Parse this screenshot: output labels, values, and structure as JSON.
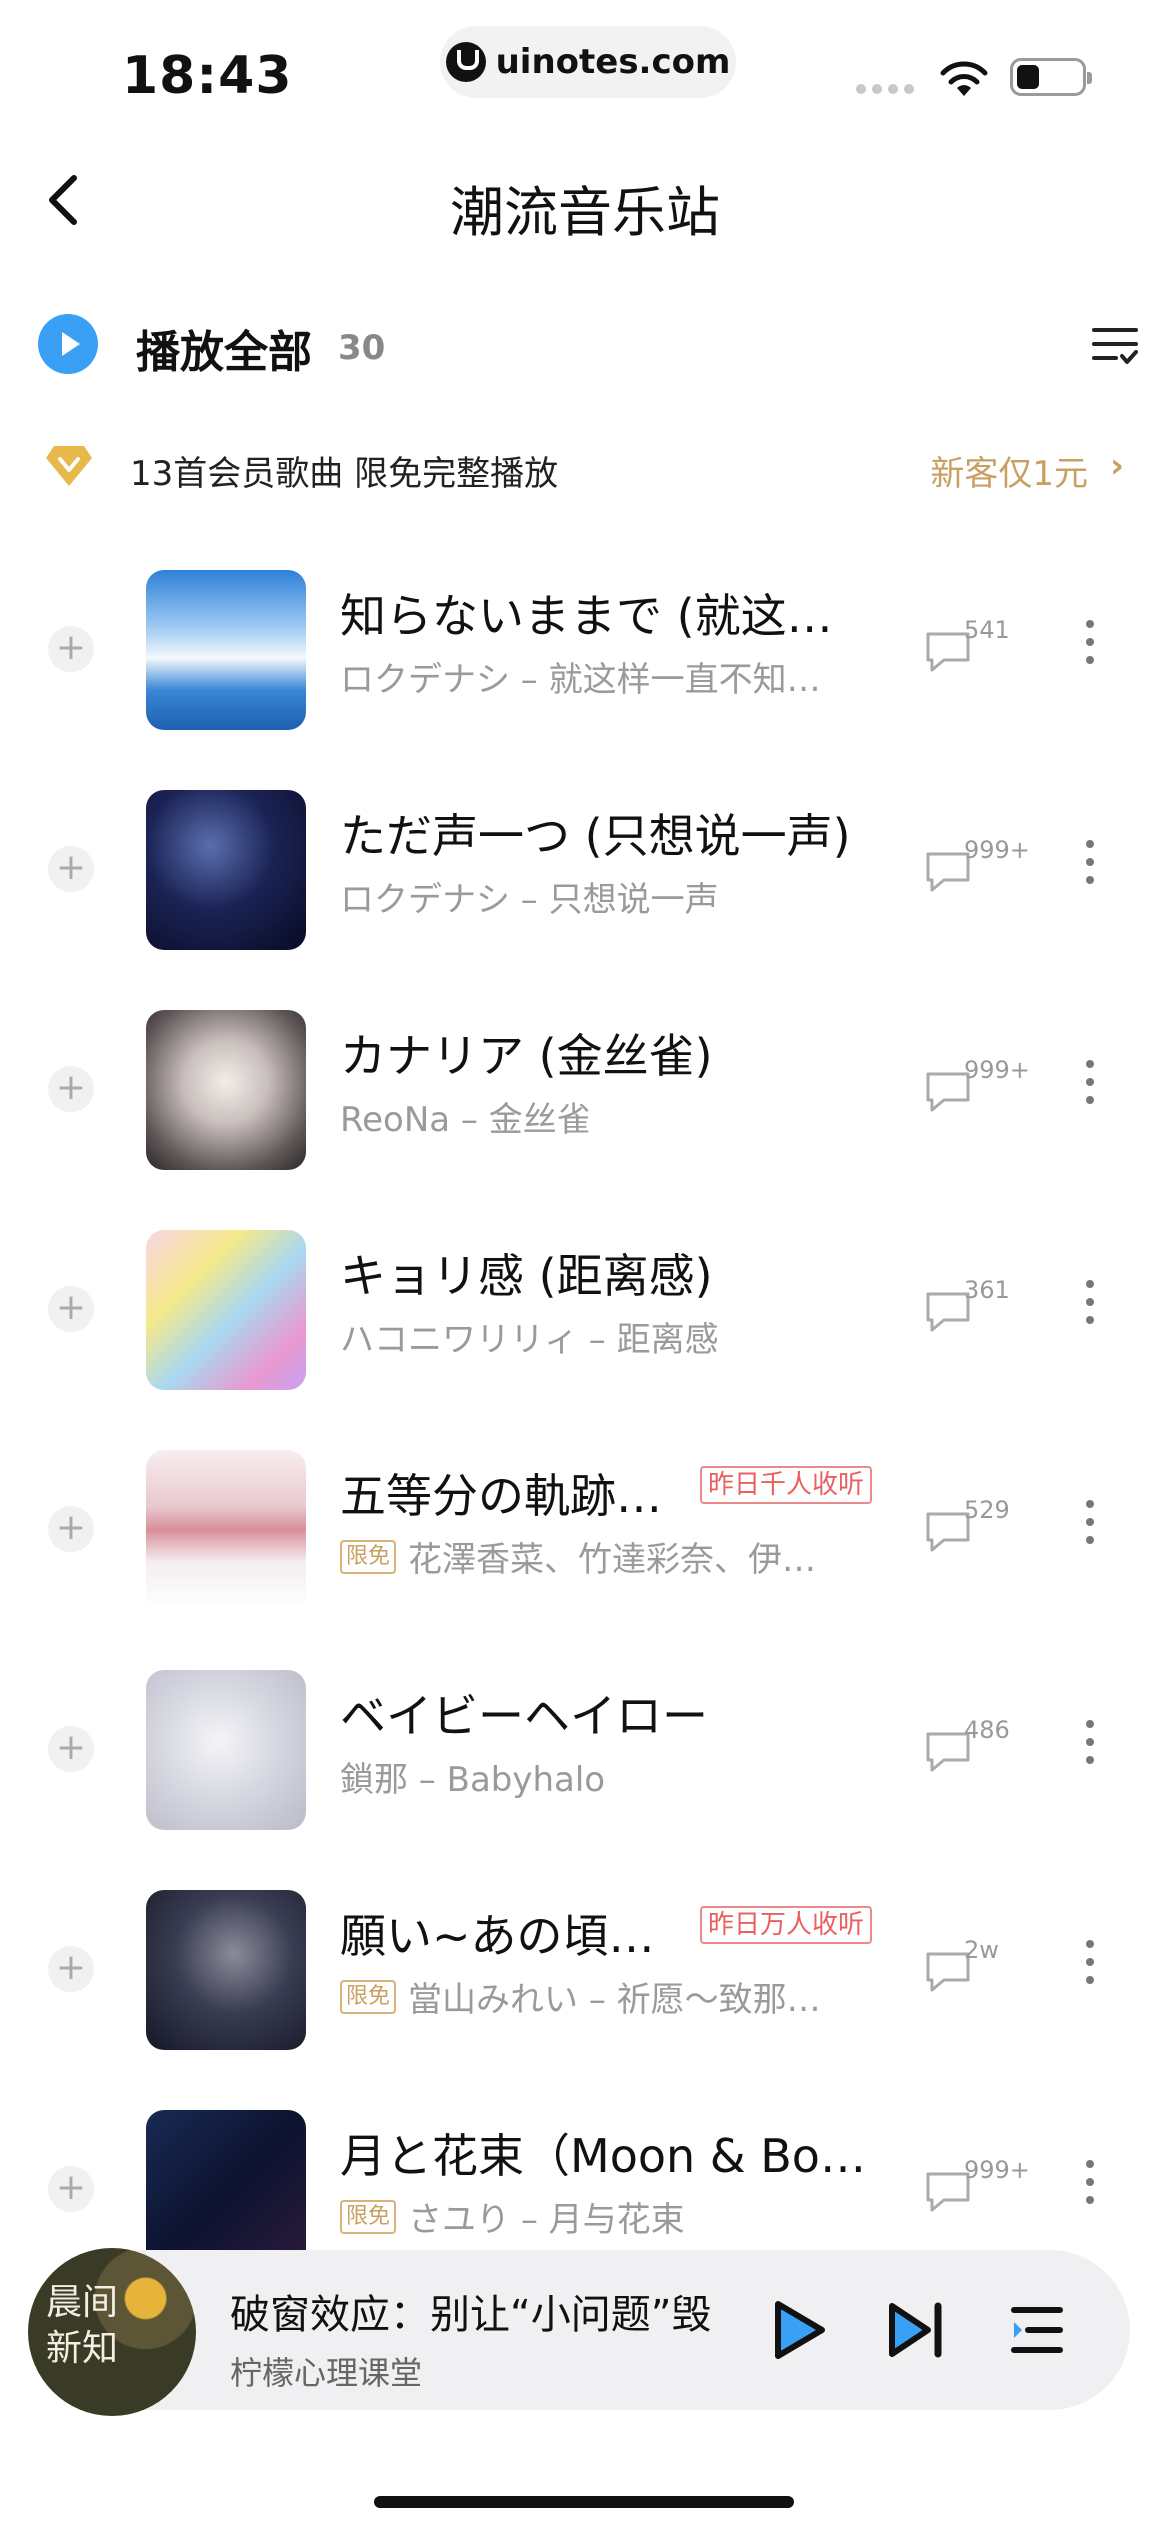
{
  "status_bar": {
    "time": "18:43",
    "url": "uinotes.com"
  },
  "nav": {
    "title": "潮流音乐站"
  },
  "play_all": {
    "label": "播放全部",
    "count": "30"
  },
  "vip_banner": {
    "text": "13首会员歌曲 限免完整播放",
    "cta": "新客仅1元",
    "chevron": "›"
  },
  "songs": [
    {
      "title": "知らないままで (就这样…",
      "subtitle": "ロクデナシ – 就这样一直不知…",
      "tag": "",
      "hot": "",
      "comments": "541"
    },
    {
      "title": "ただ声一つ (只想说一声)",
      "subtitle": "ロクデナシ – 只想说一声",
      "tag": "",
      "hot": "",
      "comments": "999+"
    },
    {
      "title": "カナリア (金丝雀)",
      "subtitle": "ReoNa – 金丝雀",
      "tag": "",
      "hot": "",
      "comments": "999+"
    },
    {
      "title": "キョリ感 (距离感)",
      "subtitle": "ハコニワリリィ – 距离感",
      "tag": "",
      "hot": "",
      "comments": "361"
    },
    {
      "title": "五等分の軌跡…",
      "subtitle": "花澤香菜、竹達彩奈、伊…",
      "tag": "限免",
      "hot": "昨日千人收听",
      "comments": "529"
    },
    {
      "title": "ベイビーヘイロー",
      "subtitle": "鎖那 – Babyhalo",
      "tag": "",
      "hot": "",
      "comments": "486"
    },
    {
      "title": "願い~あの頃の…",
      "subtitle": "當山みれい – 祈愿～致那…",
      "tag": "限免",
      "hot": "昨日万人收听",
      "comments": "2w"
    },
    {
      "title": "月と花束（Moon & Bo…",
      "subtitle": "さユり – 月与花束",
      "tag": "限免",
      "hot": "",
      "comments": "999+"
    }
  ],
  "mini_player": {
    "cover_text": "晨间新知",
    "title": "破窗效应：别让“小问题”毁",
    "artist": "柠檬心理课堂"
  }
}
